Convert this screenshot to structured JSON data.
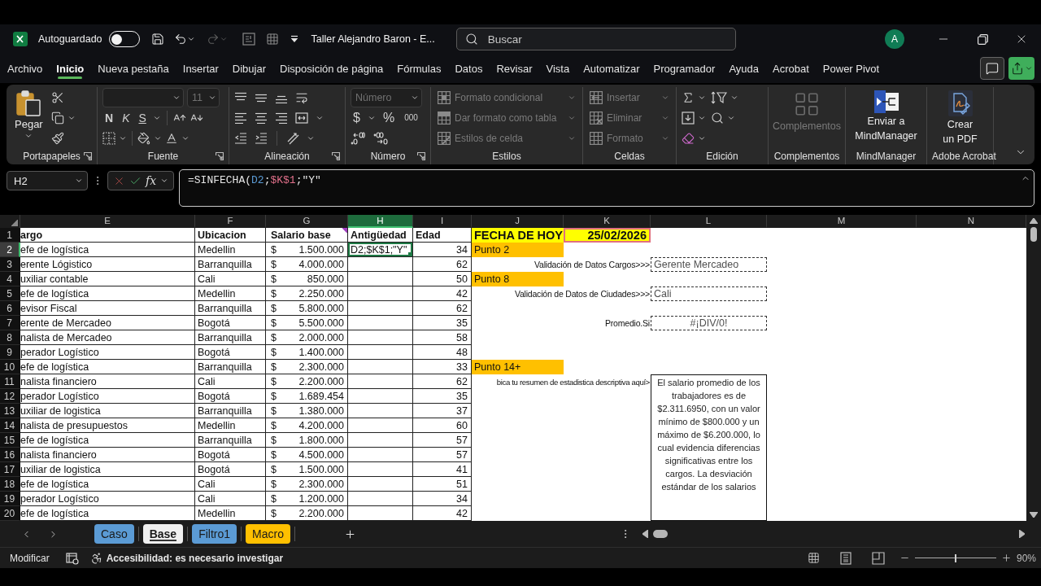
{
  "title_bar": {
    "autosave_label": "Autoguardado",
    "autosave_on": false,
    "redo_disabled": true,
    "document_title": "Taller Alejandro Baron - E...",
    "search_placeholder": "Buscar",
    "avatar": "A"
  },
  "ribbon_tabs": [
    {
      "label": "Archivo",
      "selected": false
    },
    {
      "label": "Inicio",
      "selected": true
    },
    {
      "label": "Nueva pestaña",
      "selected": false
    },
    {
      "label": "Insertar",
      "selected": false
    },
    {
      "label": "Dibujar",
      "selected": false
    },
    {
      "label": "Disposición de página",
      "selected": false
    },
    {
      "label": "Fórmulas",
      "selected": false
    },
    {
      "label": "Datos",
      "selected": false
    },
    {
      "label": "Revisar",
      "selected": false
    },
    {
      "label": "Vista",
      "selected": false
    },
    {
      "label": "Automatizar",
      "selected": false
    },
    {
      "label": "Programador",
      "selected": false
    },
    {
      "label": "Ayuda",
      "selected": false
    },
    {
      "label": "Acrobat",
      "selected": false
    },
    {
      "label": "Power Pivot",
      "selected": false
    }
  ],
  "ribbon_groups": [
    {
      "kind": "clipboard",
      "label": "Portapapeles",
      "launcher": true,
      "paste": "Pegar"
    },
    {
      "kind": "font",
      "label": "Fuente",
      "launcher": true,
      "font_size": "11",
      "size_disabled": true,
      "bold": "N",
      "italic": "K",
      "underline": "S"
    },
    {
      "kind": "alignment",
      "label": "Alineación",
      "launcher": true
    },
    {
      "kind": "number",
      "label": "Número",
      "launcher": true,
      "format": "Número",
      "format_disabled": true,
      "currency": "$",
      "percent": "%",
      "thousands": "000"
    },
    {
      "kind": "list",
      "label": "Estilos",
      "launcher": false,
      "items": [
        {
          "kind": "conditional",
          "label": "Formato condicional",
          "disabled": true
        },
        {
          "kind": "table",
          "label": "Dar formato como tabla",
          "disabled": true
        },
        {
          "kind": "style",
          "label": "Estilos de celda",
          "disabled": true
        }
      ]
    },
    {
      "kind": "list",
      "label": "Celdas",
      "launcher": false,
      "items": [
        {
          "kind": "insert",
          "label": "Insertar",
          "disabled": true
        },
        {
          "kind": "delete",
          "label": "Eliminar",
          "disabled": true
        },
        {
          "kind": "format",
          "label": "Formato",
          "disabled": true
        }
      ]
    },
    {
      "kind": "editing",
      "label": "Edición",
      "launcher": false
    },
    {
      "kind": "addins",
      "label": "Complementos",
      "lines": [
        "Complementos"
      ],
      "disabled": true
    },
    {
      "kind": "mindmap",
      "label": "MindManager",
      "lines": [
        "Enviar a",
        "MindManager"
      ],
      "disabled": false
    },
    {
      "kind": "pdf",
      "label": "Adobe Acrobat",
      "lines": [
        "Crear",
        "un PDF"
      ],
      "disabled": false
    }
  ],
  "formula_bar": {
    "name_box": "H2",
    "function_label": "fx",
    "formula": [
      {
        "text": "=SINFECHA(",
        "color": "#e6e6e6"
      },
      {
        "text": "D2",
        "color": "#5b9bd5"
      },
      {
        "text": ";",
        "color": "#e6e6e6"
      },
      {
        "text": "$K$1",
        "color": "#e0708a"
      },
      {
        "text": ";\"Y\"",
        "color": "#e6e6e6"
      }
    ]
  },
  "sheet": {
    "columns": [
      {
        "label": "E",
        "selected": false
      },
      {
        "label": "F",
        "selected": false
      },
      {
        "label": "G",
        "selected": false
      },
      {
        "label": "H",
        "selected": true
      },
      {
        "label": "I",
        "selected": false
      },
      {
        "label": "J",
        "selected": false
      },
      {
        "label": "K",
        "selected": false
      },
      {
        "label": "L",
        "selected": false
      },
      {
        "label": "M",
        "selected": false
      },
      {
        "label": "N",
        "selected": false
      }
    ],
    "header_row": {
      "number": "1",
      "selected": false,
      "cargo": "argo",
      "ubicacion": "Ubicacion",
      "salario": "Salario base",
      "salario_note": true,
      "antiguedad": "Antigüedad",
      "edad": "Edad",
      "side": [
        {
          "kind": "title",
          "text": "FECHA DE HOY"
        },
        {
          "kind": "date",
          "text": "25/02/2026",
          "referenced": true
        }
      ]
    },
    "rows": [
      {
        "number": "2",
        "selected": true,
        "active": true,
        "cargo": "efe de logística",
        "ubicacion": "Medellin",
        "currency": "$",
        "salario": "1.500.000",
        "antiguedad": "D2;$K$1;\"Y\"",
        "edad": "34",
        "side": [
          {
            "kind": "section",
            "text": "Punto 2"
          }
        ]
      },
      {
        "number": "3",
        "selected": false,
        "active": false,
        "cargo": "erente Lógistico",
        "ubicacion": "Barranquilla",
        "currency": "$",
        "salario": "4.000.000",
        "edad": "62",
        "side": [
          {
            "kind": "label",
            "text": "Validación de Datos Cargos>>>"
          },
          {
            "kind": "input",
            "text": "Gerente Mercadeo"
          }
        ]
      },
      {
        "number": "4",
        "selected": false,
        "active": false,
        "cargo": "uxiliar contable",
        "ubicacion": "Cali",
        "currency": "$",
        "salario": "850.000",
        "edad": "50",
        "side": [
          {
            "kind": "section",
            "text": "Punto 8"
          }
        ]
      },
      {
        "number": "5",
        "selected": false,
        "active": false,
        "cargo": "efe de logística",
        "ubicacion": "Medellin",
        "currency": "$",
        "salario": "2.250.000",
        "edad": "42",
        "side": [
          {
            "kind": "label",
            "text": "Validación de Datos de Ciudades>>>"
          },
          {
            "kind": "input",
            "text": "Cali"
          }
        ]
      },
      {
        "number": "6",
        "selected": false,
        "active": false,
        "cargo": "evisor Fiscal",
        "ubicacion": "Barranquilla",
        "currency": "$",
        "salario": "5.800.000",
        "edad": "62"
      },
      {
        "number": "7",
        "selected": false,
        "active": false,
        "cargo": "erente de Mercadeo",
        "ubicacion": "Bogotá",
        "currency": "$",
        "salario": "5.500.000",
        "edad": "35",
        "side": [
          {
            "kind": "label",
            "text": "Promedio.Si"
          },
          {
            "kind": "result",
            "text": "#¡DIV/0!"
          }
        ]
      },
      {
        "number": "8",
        "selected": false,
        "active": false,
        "cargo": "nalista de Mercadeo",
        "ubicacion": "Barranquilla",
        "currency": "$",
        "salario": "2.000.000",
        "edad": "58"
      },
      {
        "number": "9",
        "selected": false,
        "active": false,
        "cargo": "perador Logístico",
        "ubicacion": "Bogotá",
        "currency": "$",
        "salario": "1.400.000",
        "edad": "48"
      },
      {
        "number": "10",
        "selected": false,
        "active": false,
        "cargo": "efe de logística",
        "ubicacion": "Barranquilla",
        "currency": "$",
        "salario": "2.300.000",
        "edad": "33",
        "side": [
          {
            "kind": "section",
            "text": "Punto 14+"
          }
        ]
      },
      {
        "number": "11",
        "selected": false,
        "active": false,
        "cargo": "nalista financiero",
        "ubicacion": "Cali",
        "currency": "$",
        "salario": "2.200.000",
        "edad": "62",
        "side": [
          {
            "kind": "label",
            "text": "bica tu resumen de estadistica descriptiva aquí>"
          }
        ]
      },
      {
        "number": "12",
        "selected": false,
        "active": false,
        "cargo": "perador Logístico",
        "ubicacion": "Bogotá",
        "currency": "$",
        "salario": "1.689.454",
        "edad": "35"
      },
      {
        "number": "13",
        "selected": false,
        "active": false,
        "cargo": "uxiliar de logistica",
        "ubicacion": "Barranquilla",
        "currency": "$",
        "salario": "1.380.000",
        "edad": "37"
      },
      {
        "number": "14",
        "selected": false,
        "active": false,
        "cargo": "nalista de presupuestos",
        "ubicacion": "Medellin",
        "currency": "$",
        "salario": "4.200.000",
        "edad": "60"
      },
      {
        "number": "15",
        "selected": false,
        "active": false,
        "cargo": "efe de logística",
        "ubicacion": "Barranquilla",
        "currency": "$",
        "salario": "1.800.000",
        "edad": "57"
      },
      {
        "number": "16",
        "selected": false,
        "active": false,
        "cargo": "nalista financiero",
        "ubicacion": "Bogotá",
        "currency": "$",
        "salario": "4.500.000",
        "edad": "57"
      },
      {
        "number": "17",
        "selected": false,
        "active": false,
        "cargo": "uxiliar de logistica",
        "ubicacion": "Bogotá",
        "currency": "$",
        "salario": "1.500.000",
        "edad": "41"
      },
      {
        "number": "18",
        "selected": false,
        "active": false,
        "cargo": "efe de logística",
        "ubicacion": "Cali",
        "currency": "$",
        "salario": "2.300.000",
        "edad": "51"
      },
      {
        "number": "19",
        "selected": false,
        "active": false,
        "cargo": "perador Logístico",
        "ubicacion": "Cali",
        "currency": "$",
        "salario": "1.200.000",
        "edad": "34"
      },
      {
        "number": "20",
        "selected": false,
        "active": false,
        "cargo": "efe de logística",
        "ubicacion": "Medellin",
        "currency": "$",
        "salario": "2.200.000",
        "edad": "42"
      }
    ],
    "text_box": {
      "text": "El salario promedio de los trabajadores es de $2.311.6950, con un valor mínimo de $800.000 y un máximo de $6.200.000, lo cual evidencia diferencias significativas entre los cargos. La desviación estándar de los salarios"
    }
  },
  "sheet_tabs": [
    {
      "label": "Caso",
      "selected": false,
      "color": "#5b9bd5"
    },
    {
      "label": "Base",
      "selected": true
    },
    {
      "label": "Filtro1",
      "selected": false,
      "color": "#5b9bd5"
    },
    {
      "label": "Macro",
      "selected": false,
      "color": "#ffc000"
    }
  ],
  "status_bar": {
    "mode": "Modificar",
    "accessibility": "Accesibilidad: es necesario investigar",
    "zoom_slider": {
      "level": 0.5
    },
    "zoom_label": "90%"
  }
}
